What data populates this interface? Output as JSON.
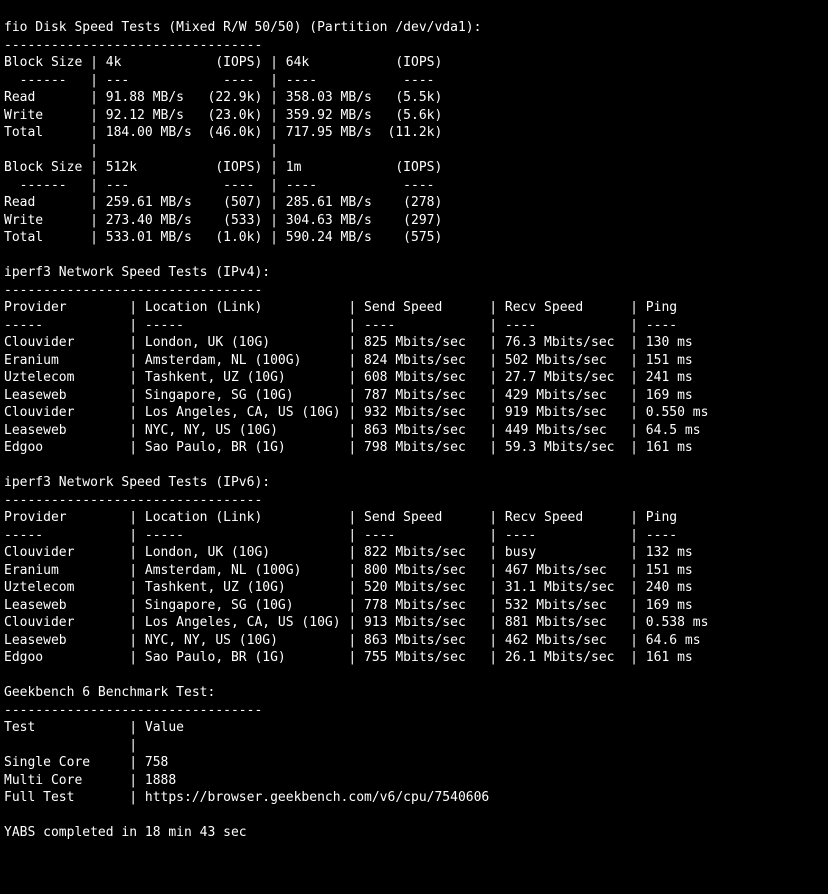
{
  "fio": {
    "title": "fio Disk Speed Tests (Mixed R/W 50/50) (Partition /dev/vda1):",
    "dashes": "---------------------------------",
    "block1": {
      "hdr": "Block Size | 4k            (IOPS) | 64k           (IOPS)",
      "sep": "  ------   | ---            ----  | ----           ---- ",
      "read": "Read       | 91.88 MB/s   (22.9k) | 358.03 MB/s   (5.5k)",
      "write": "Write      | 92.12 MB/s   (23.0k) | 359.92 MB/s   (5.6k)",
      "total": "Total      | 184.00 MB/s  (46.0k) | 717.95 MB/s  (11.2k)"
    },
    "block2": {
      "gap": "           |                      |                     ",
      "hdr": "Block Size | 512k          (IOPS) | 1m            (IOPS)",
      "sep": "  ------   | ---            ----  | ----           ---- ",
      "read": "Read       | 259.61 MB/s    (507) | 285.61 MB/s    (278)",
      "write": "Write      | 273.40 MB/s    (533) | 304.63 MB/s    (297)",
      "total": "Total      | 533.01 MB/s   (1.0k) | 590.24 MB/s    (575)"
    }
  },
  "iperf4": {
    "title": "iperf3 Network Speed Tests (IPv4):",
    "dashes": "---------------------------------",
    "hdr": "Provider        | Location (Link)           | Send Speed      | Recv Speed      | Ping           ",
    "sep": "-----           | -----                     | ----            | ----            | ----           ",
    "rows": [
      "Clouvider       | London, UK (10G)          | 825 Mbits/sec   | 76.3 Mbits/sec  | 130 ms         ",
      "Eranium         | Amsterdam, NL (100G)      | 824 Mbits/sec   | 502 Mbits/sec   | 151 ms         ",
      "Uztelecom       | Tashkent, UZ (10G)        | 608 Mbits/sec   | 27.7 Mbits/sec  | 241 ms         ",
      "Leaseweb        | Singapore, SG (10G)       | 787 Mbits/sec   | 429 Mbits/sec   | 169 ms         ",
      "Clouvider       | Los Angeles, CA, US (10G) | 932 Mbits/sec   | 919 Mbits/sec   | 0.550 ms       ",
      "Leaseweb        | NYC, NY, US (10G)         | 863 Mbits/sec   | 449 Mbits/sec   | 64.5 ms        ",
      "Edgoo           | Sao Paulo, BR (1G)        | 798 Mbits/sec   | 59.3 Mbits/sec  | 161 ms         "
    ]
  },
  "iperf6": {
    "title": "iperf3 Network Speed Tests (IPv6):",
    "dashes": "---------------------------------",
    "hdr": "Provider        | Location (Link)           | Send Speed      | Recv Speed      | Ping           ",
    "sep": "-----           | -----                     | ----            | ----            | ----           ",
    "rows": [
      "Clouvider       | London, UK (10G)          | 822 Mbits/sec   | busy            | 132 ms         ",
      "Eranium         | Amsterdam, NL (100G)      | 800 Mbits/sec   | 467 Mbits/sec   | 151 ms         ",
      "Uztelecom       | Tashkent, UZ (10G)        | 520 Mbits/sec   | 31.1 Mbits/sec  | 240 ms         ",
      "Leaseweb        | Singapore, SG (10G)       | 778 Mbits/sec   | 532 Mbits/sec   | 169 ms         ",
      "Clouvider       | Los Angeles, CA, US (10G) | 913 Mbits/sec   | 881 Mbits/sec   | 0.538 ms       ",
      "Leaseweb        | NYC, NY, US (10G)         | 863 Mbits/sec   | 462 Mbits/sec   | 64.6 ms        ",
      "Edgoo           | Sao Paulo, BR (1G)        | 755 Mbits/sec   | 26.1 Mbits/sec  | 161 ms         "
    ]
  },
  "geekbench": {
    "title": "Geekbench 6 Benchmark Test:",
    "dashes": "---------------------------------",
    "hdr": "Test            | Value                                                         ",
    "gap": "                |                                                               ",
    "single": "Single Core     | 758                           ",
    "multi": "Multi Core      | 1888                          ",
    "full": "Full Test       | https://browser.geekbench.com/v6/cpu/7540606"
  },
  "footer": "YABS completed in 18 min 43 sec"
}
